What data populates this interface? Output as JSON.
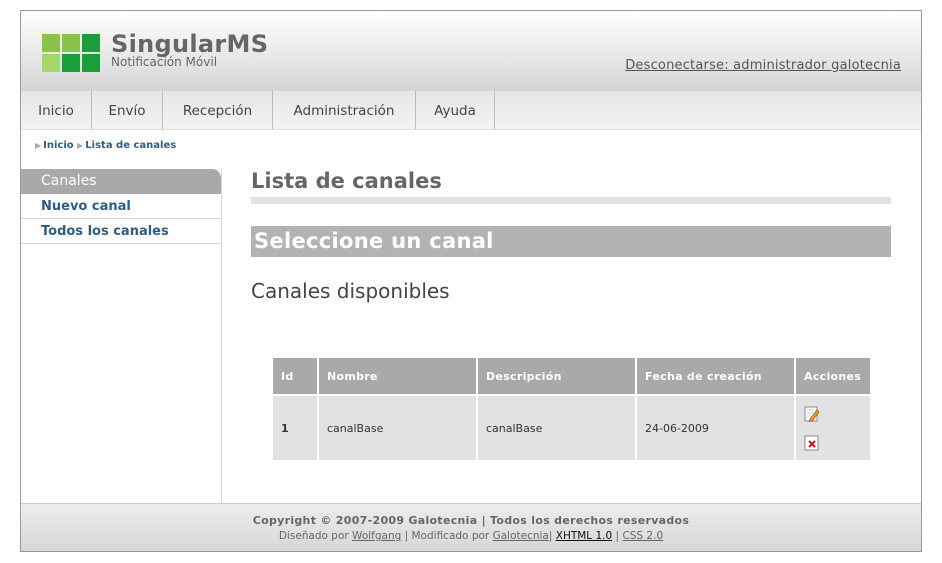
{
  "header": {
    "app_name": "SingularMS",
    "app_subtitle": "Notificación Móvil",
    "logout_link": "Desconectarse: administrador galotecnia",
    "logo_colors": [
      "#8bc34a",
      "#8bc34a",
      "#1b9e3a",
      "#a5d66a",
      "#1b9e3a",
      "#1b9e3a"
    ]
  },
  "nav": {
    "tabs": [
      "Inicio",
      "Envío",
      "Recepción",
      "Administración",
      "Ayuda"
    ]
  },
  "breadcrumb": {
    "items": [
      "Inicio",
      "Lista de canales"
    ]
  },
  "sidebar": {
    "heading": "Canales",
    "items": [
      "Nuevo canal",
      "Todos los canales"
    ]
  },
  "main": {
    "title": "Lista de canales",
    "band": "Seleccione un canal",
    "subtitle": "Canales disponibles"
  },
  "table": {
    "headers": [
      "Id",
      "Nombre",
      "Descripción",
      "Fecha de creación",
      "Acciones"
    ],
    "rows": [
      {
        "id": "1",
        "nombre": "canalBase",
        "descripcion": "canalBase",
        "fecha": "24-06-2009",
        "actions": [
          "edit-icon",
          "delete-icon"
        ]
      }
    ]
  },
  "footer": {
    "copyright": "Copyright © 2007-2009 Galotecnia | Todos los derechos reservados",
    "designed_prefix": "Diseñado por",
    "designer": "Wolfgang",
    "modified_prefix": "| Modificado por",
    "modifier": "Galotecnia",
    "sep": "|",
    "xhtml": "XHTML 1.0",
    "css": "CSS 2.0"
  }
}
